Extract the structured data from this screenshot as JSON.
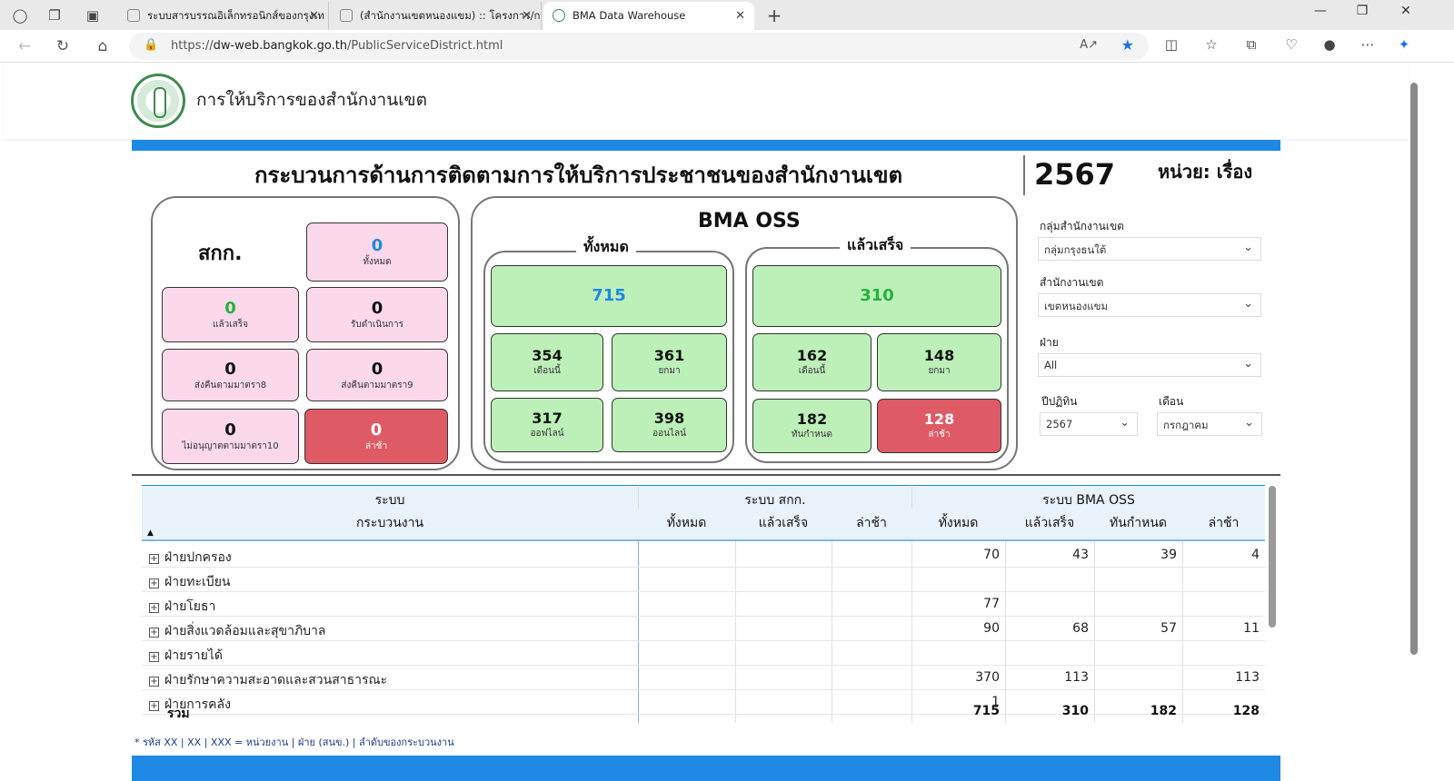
{
  "browser": {
    "tabs": [
      {
        "title": "ระบบสารบรรณอิเล็กทรอนิกส์ของกรุงเท"
      },
      {
        "title": "(สำนักงานเขตหนองแขม) :: โครงการ/ก"
      },
      {
        "title": "BMA Data Warehouse"
      }
    ],
    "url_prefix": "https://",
    "url_host": "dw-web.bangkok.go.th",
    "url_path": "/PublicServiceDistrict.html"
  },
  "header": {
    "site_title": "การให้บริการของสำนักงานเขต"
  },
  "report": {
    "title": "กระบวนการด้านการติดตามการให้บริการประชาชนของสำนักงานเขต",
    "year": "2567",
    "unit": "หน่วย: เรื่อง"
  },
  "skk": {
    "title": "สกก.",
    "cards": {
      "total": {
        "value": "0",
        "label": "ทั้งหมด"
      },
      "done": {
        "value": "0",
        "label": "แล้วเสร็จ"
      },
      "accepted": {
        "value": "0",
        "label": "รับดำเนินการ"
      },
      "return8": {
        "value": "0",
        "label": "ส่งคืนตามมาตรา8"
      },
      "return9": {
        "value": "0",
        "label": "ส่งคืนตามมาตรา9"
      },
      "notallowed10": {
        "value": "0",
        "label": "ไม่อนุญาตตามมาตรา10"
      },
      "late": {
        "value": "0",
        "label": "ล่าช้า"
      }
    }
  },
  "oss": {
    "title": "BMA OSS",
    "all": {
      "label": "ทั้งหมด",
      "total": "715",
      "this_month": {
        "value": "354",
        "label": "เดือนนี้"
      },
      "carried": {
        "value": "361",
        "label": "ยกมา"
      },
      "offline": {
        "value": "317",
        "label": "ออฟไลน์"
      },
      "online": {
        "value": "398",
        "label": "ออนไลน์"
      }
    },
    "done": {
      "label": "แล้วเสร็จ",
      "total": "310",
      "this_month": {
        "value": "162",
        "label": "เดือนนี้"
      },
      "carried": {
        "value": "148",
        "label": "ยกมา"
      },
      "ontime": {
        "value": "182",
        "label": "ทันกำหนด"
      },
      "late": {
        "value": "128",
        "label": "ล่าช้า"
      }
    }
  },
  "filters": {
    "group_label": "กลุ่มสำนักงานเขต",
    "group_value": "กลุ่มกรุงธนใต้",
    "district_label": "สำนักงานเขต",
    "district_value": "เขตหนองแขม",
    "dept_label": "ฝ่าย",
    "dept_value": "All",
    "fiscal_label": "ปีปฏิทิน",
    "fiscal_value": "2567",
    "month_label": "เดือน",
    "month_value": "กรกฎาคม"
  },
  "table": {
    "group_system": "ระบบ",
    "group_skk": "ระบบ สกก.",
    "group_oss": "ระบบ BMA OSS",
    "col_process": "กระบวนงาน",
    "col_skk_total": "ทั้งหมด",
    "col_skk_done": "แล้วเสร็จ",
    "col_skk_late": "ล่าช้า",
    "col_oss_total": "ทั้งหมด",
    "col_oss_done": "แล้วเสร็จ",
    "col_oss_ontime": "ทันกำหนด",
    "col_oss_late": "ล่าช้า",
    "rows": [
      {
        "name": "ฝ่ายปกครอง",
        "oss_total": "70",
        "oss_done": "43",
        "oss_ontime": "39",
        "oss_late": "4"
      },
      {
        "name": "ฝ่ายทะเบียน",
        "oss_total": "",
        "oss_done": "",
        "oss_ontime": "",
        "oss_late": ""
      },
      {
        "name": "ฝ่ายโยธา",
        "oss_total": "77",
        "oss_done": "",
        "oss_ontime": "",
        "oss_late": ""
      },
      {
        "name": "ฝ่ายสิ่งแวดล้อมและสุขาภิบาล",
        "oss_total": "90",
        "oss_done": "68",
        "oss_ontime": "57",
        "oss_late": "11"
      },
      {
        "name": "ฝ่ายรายได้",
        "oss_total": "",
        "oss_done": "",
        "oss_ontime": "",
        "oss_late": ""
      },
      {
        "name": "ฝ่ายรักษาความสะอาดและสวนสาธารณะ",
        "oss_total": "370",
        "oss_done": "113",
        "oss_ontime": "",
        "oss_late": "113"
      },
      {
        "name": "ฝ่ายการคลัง",
        "oss_total": "1",
        "oss_done": "",
        "oss_ontime": "",
        "oss_late": ""
      }
    ],
    "total_label": "รวม",
    "totals": {
      "oss_total": "715",
      "oss_done": "310",
      "oss_ontime": "182",
      "oss_late": "128"
    }
  },
  "footnote": "* รหัส XX | XX | XXX = หน่วยงาน | ฝ่าย (สนข.) | ลำดับของกระบวนงาน"
}
